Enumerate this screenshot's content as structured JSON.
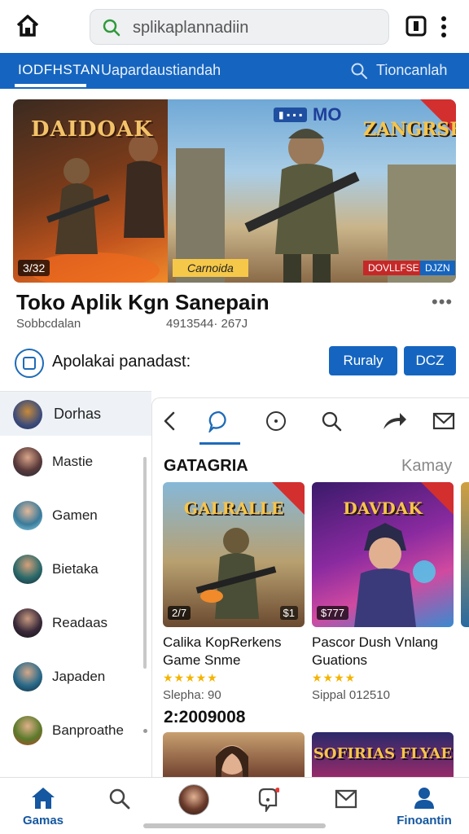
{
  "topbar": {
    "search_value": "splikaplannadiin"
  },
  "navstrip": {
    "tab_active": "IODFHSTAN",
    "tab_second": "Uapardaustiandah",
    "tab_third": "Tioncanlah"
  },
  "hero": {
    "title_left": "DAIDOAK",
    "title_right": "ZANGRSK",
    "badge_num": "MO",
    "count": "3/32",
    "tag": "Carnoida",
    "red_badge": "DOVLLFSE",
    "blue_badge": "DJZN"
  },
  "app": {
    "title": "Toko Aplik Kgn Sanepain",
    "subtitle": "Sobbcdalan",
    "meta": "4913544· 267J",
    "more": "•••"
  },
  "actions": {
    "label": "Apolakai panadast:",
    "button_1": "Ruraly",
    "button_2": "DCZ"
  },
  "leftlist": {
    "header": "Dorhas",
    "items": [
      {
        "label": "Mastie"
      },
      {
        "label": "Gamen"
      },
      {
        "label": "Bietaka"
      },
      {
        "label": "Readaas"
      },
      {
        "label": "Japaden"
      },
      {
        "label": "Banproathe"
      }
    ]
  },
  "rightpanel": {
    "category_title": "GATAGRIA",
    "category_more": "Kamay",
    "cards": [
      {
        "art_title": "GALRALLE",
        "badge_left": "2/7",
        "badge_right": "$1",
        "title": "Calika KopRerkens Game Snme",
        "stars": "★★★★★",
        "meta": "Slepha: 90"
      },
      {
        "art_title": "DAVDAK",
        "badge_left": "$777",
        "title": "Pascor Dush Vnlang Guations",
        "stars": "★★★★",
        "meta": "Sippal 012510"
      }
    ],
    "price": "2:2009008",
    "lower_art_title": "SOFIRIAS FLYAE"
  },
  "bottomnav": {
    "items": [
      {
        "label": "Gamas"
      },
      {
        "label": ""
      },
      {
        "label": ""
      },
      {
        "label": ""
      },
      {
        "label": ""
      },
      {
        "label": "Finoantin"
      }
    ]
  },
  "colors": {
    "primary": "#1565c0",
    "accent_red": "#d32f2f",
    "star": "#f4b400"
  }
}
